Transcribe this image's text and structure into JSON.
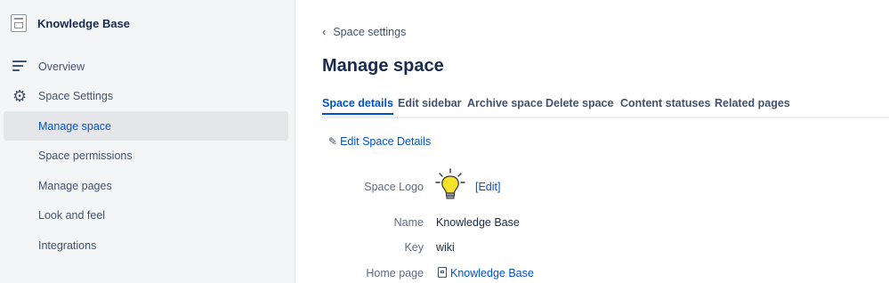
{
  "sidebar": {
    "space_name": "Knowledge Base",
    "items": [
      {
        "label": "Overview",
        "icon": "lines-icon"
      },
      {
        "label": "Space Settings",
        "icon": "gear-icon"
      },
      {
        "label": "Manage space",
        "active": true
      },
      {
        "label": "Space permissions"
      },
      {
        "label": "Manage pages"
      },
      {
        "label": "Look and feel"
      },
      {
        "label": "Integrations"
      }
    ]
  },
  "main": {
    "back_link": "Space settings",
    "title": "Manage space",
    "tabs": [
      {
        "label": "Space details",
        "active": true
      },
      {
        "label": "Edit sidebar"
      },
      {
        "label": "Archive space"
      },
      {
        "label": "Delete space"
      },
      {
        "label": "Content statuses"
      },
      {
        "label": "Related pages"
      }
    ],
    "edit_details": "Edit Space Details",
    "details": {
      "logo_label": "Space Logo",
      "logo_edit": "[Edit]",
      "name_label": "Name",
      "name_value": "Knowledge Base",
      "key_label": "Key",
      "key_value": "wiki",
      "home_label": "Home page",
      "home_value": "Knowledge Base"
    }
  },
  "colors": {
    "accent": "#0052cc",
    "sidebar_bg": "#f4f5f7",
    "text": "#172b4d"
  }
}
